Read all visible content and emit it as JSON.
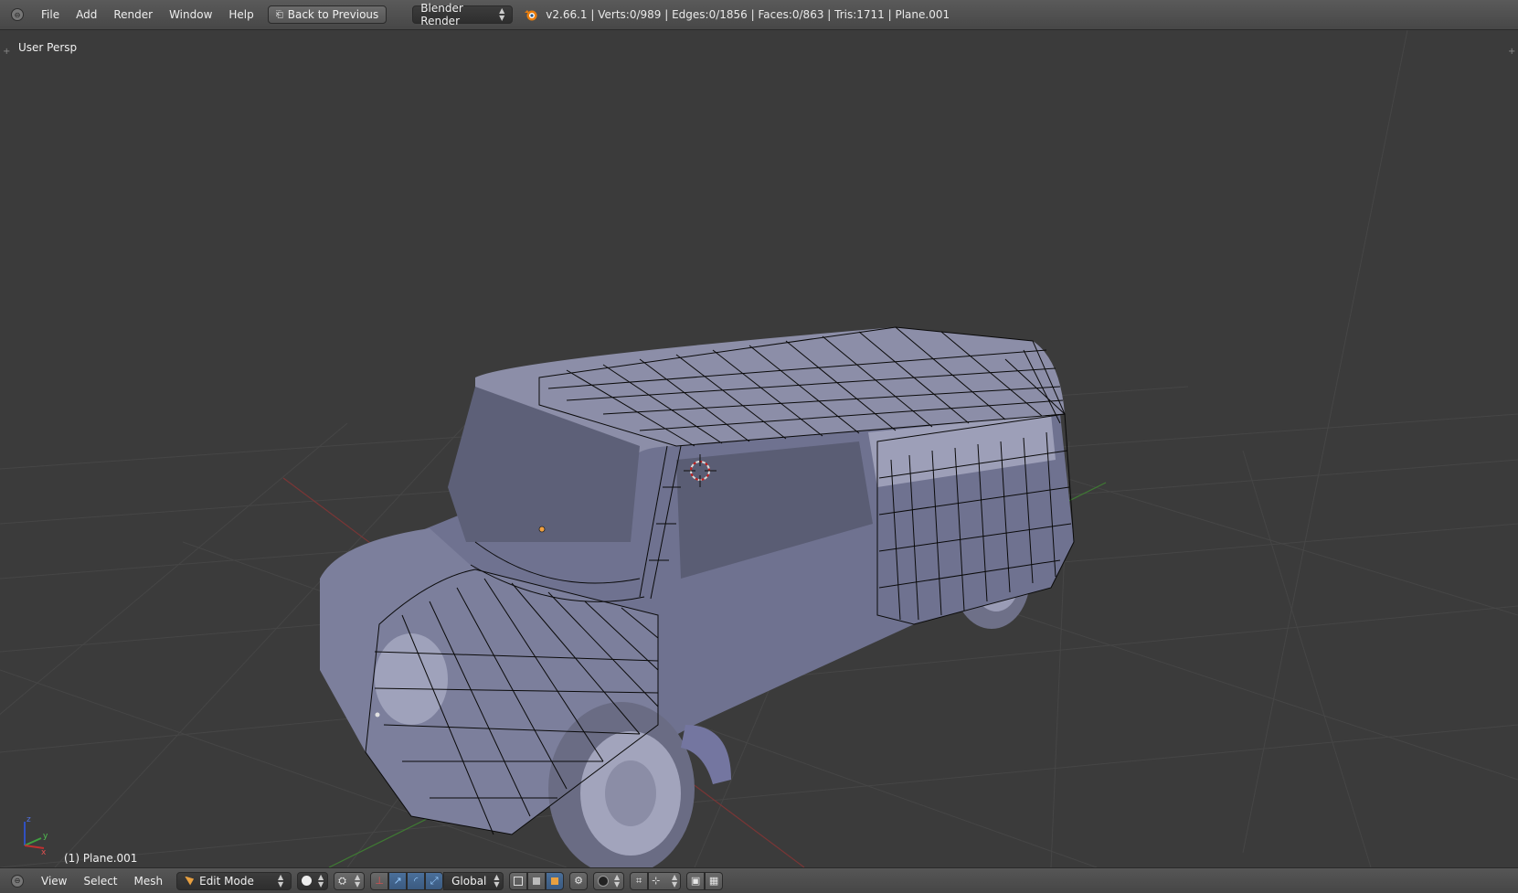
{
  "header": {
    "menu": [
      "File",
      "Add",
      "Render",
      "Window",
      "Help"
    ],
    "back_button": "Back to Previous",
    "render_engine": "Blender Render",
    "stats": "v2.66.1 | Verts:0/989 | Edges:0/1856 | Faces:0/863 | Tris:1711 | Plane.001"
  },
  "viewport": {
    "view_label": "User Persp",
    "object_label": "(1) Plane.001",
    "axis_labels": {
      "x": "x",
      "y": "y",
      "z": "z"
    }
  },
  "footer": {
    "menu": [
      "View",
      "Select",
      "Mesh"
    ],
    "mode": "Edit Mode",
    "orientation": "Global"
  },
  "icons": {
    "collapse": "collapse-icon",
    "blender": "blender-logo-icon",
    "mode": "edit-mode-icon",
    "shading": "solid-shading-icon",
    "pivot": "pivot-icon",
    "manipulator": "manipulator-icon",
    "select_modes": [
      "vertex-select-icon",
      "edge-select-icon",
      "face-select-icon"
    ],
    "occlude": "occlude-icon",
    "proportional": "proportional-edit-icon",
    "snap": "snap-icon",
    "render": [
      "render-still-icon",
      "render-animation-icon"
    ]
  },
  "colors": {
    "grid": "#4a4a4a",
    "x_axis": "#8a3a3a",
    "y_axis": "#4a8a3a",
    "mesh": "#8a8ca6",
    "wire": "#000000",
    "selected": "#f0a040"
  }
}
